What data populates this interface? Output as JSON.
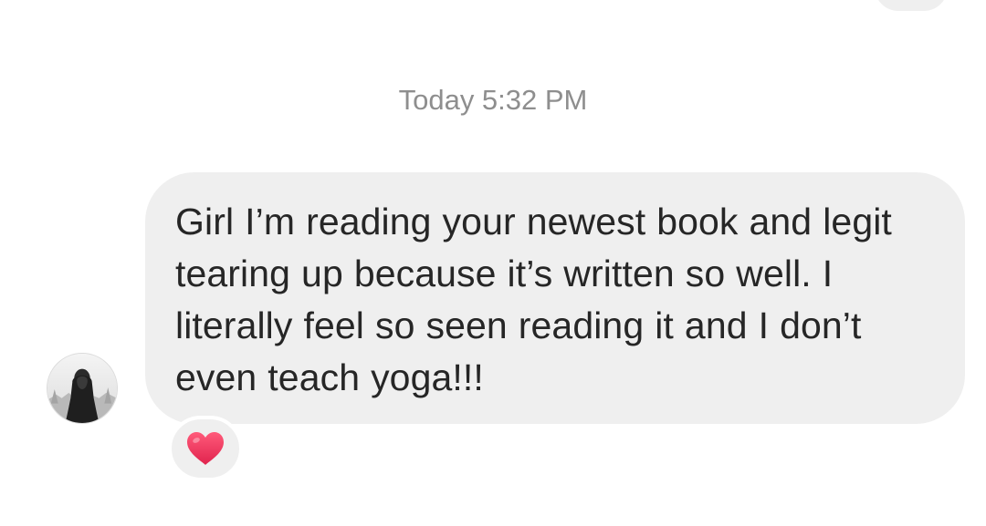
{
  "thread": {
    "timestamp": "Today 5:32 PM",
    "message": {
      "text": "Girl I’m reading your newest book and legit tearing up because it’s written so well. I literally feel so seen reading it and I don’t even teach yoga!!!",
      "reaction_icon": "red-heart-icon"
    }
  },
  "colors": {
    "bubble_bg": "#efefef",
    "timestamp_text": "#8e8e8e",
    "message_text": "#262626",
    "heart": "#f0395f"
  }
}
